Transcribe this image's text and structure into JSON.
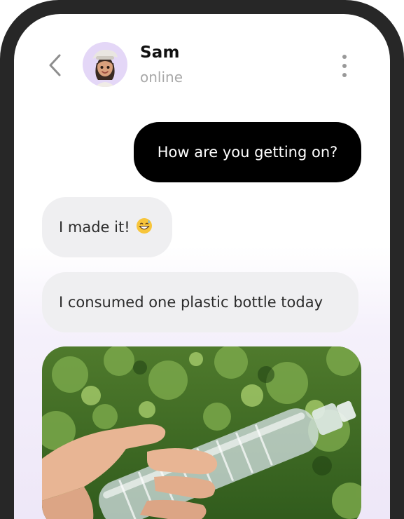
{
  "contact": {
    "name": "Sam",
    "status": "online"
  },
  "header": {
    "back_icon": "chevron-left-icon",
    "menu_icon": "more-vertical-icon"
  },
  "messages": [
    {
      "direction": "outgoing",
      "text": "How are you getting on?"
    },
    {
      "direction": "incoming",
      "text": "I made it!",
      "emoji": "grinning-face-with-sweat"
    },
    {
      "direction": "incoming",
      "text": "I consumed one plastic bottle today"
    },
    {
      "direction": "incoming",
      "type": "image",
      "subject": "hand holding an empty plastic water bottle"
    }
  ],
  "colors": {
    "frame": "#272727",
    "outgoing_bubble": "#000000",
    "incoming_bubble": "#efeff1",
    "avatar_bg": "#e4d7f7",
    "status_text": "#a8a8a8"
  }
}
